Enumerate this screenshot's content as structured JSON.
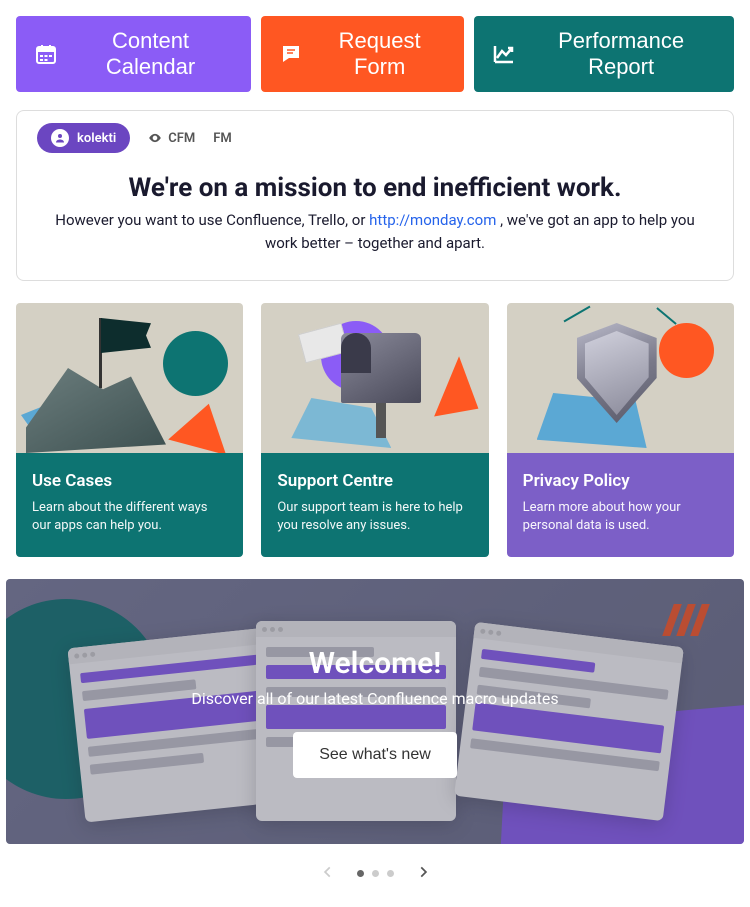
{
  "topButtons": {
    "calendar": "Content Calendar",
    "request": "Request Form",
    "report": "Performance Report"
  },
  "mission": {
    "pill": "kolekti",
    "tab_cfm": "CFM",
    "tab_fm": "FM",
    "title": "We're on a mission to end inefficient work.",
    "text_before": "However you want to use Confluence, Trello, or ",
    "link_text": "http://monday.com",
    "text_after": " , we've got an app to help you work better – together and apart."
  },
  "cards": [
    {
      "title": "Use Cases",
      "desc": "Learn about the different ways our apps can help you."
    },
    {
      "title": "Support Centre",
      "desc": "Our support team is here to help you resolve any issues."
    },
    {
      "title": "Privacy Policy",
      "desc": "Learn more about how your personal data is used."
    }
  ],
  "hero": {
    "title": "Welcome!",
    "subtitle": "Discover all of our latest Confluence macro updates",
    "cta": "See what's new"
  }
}
